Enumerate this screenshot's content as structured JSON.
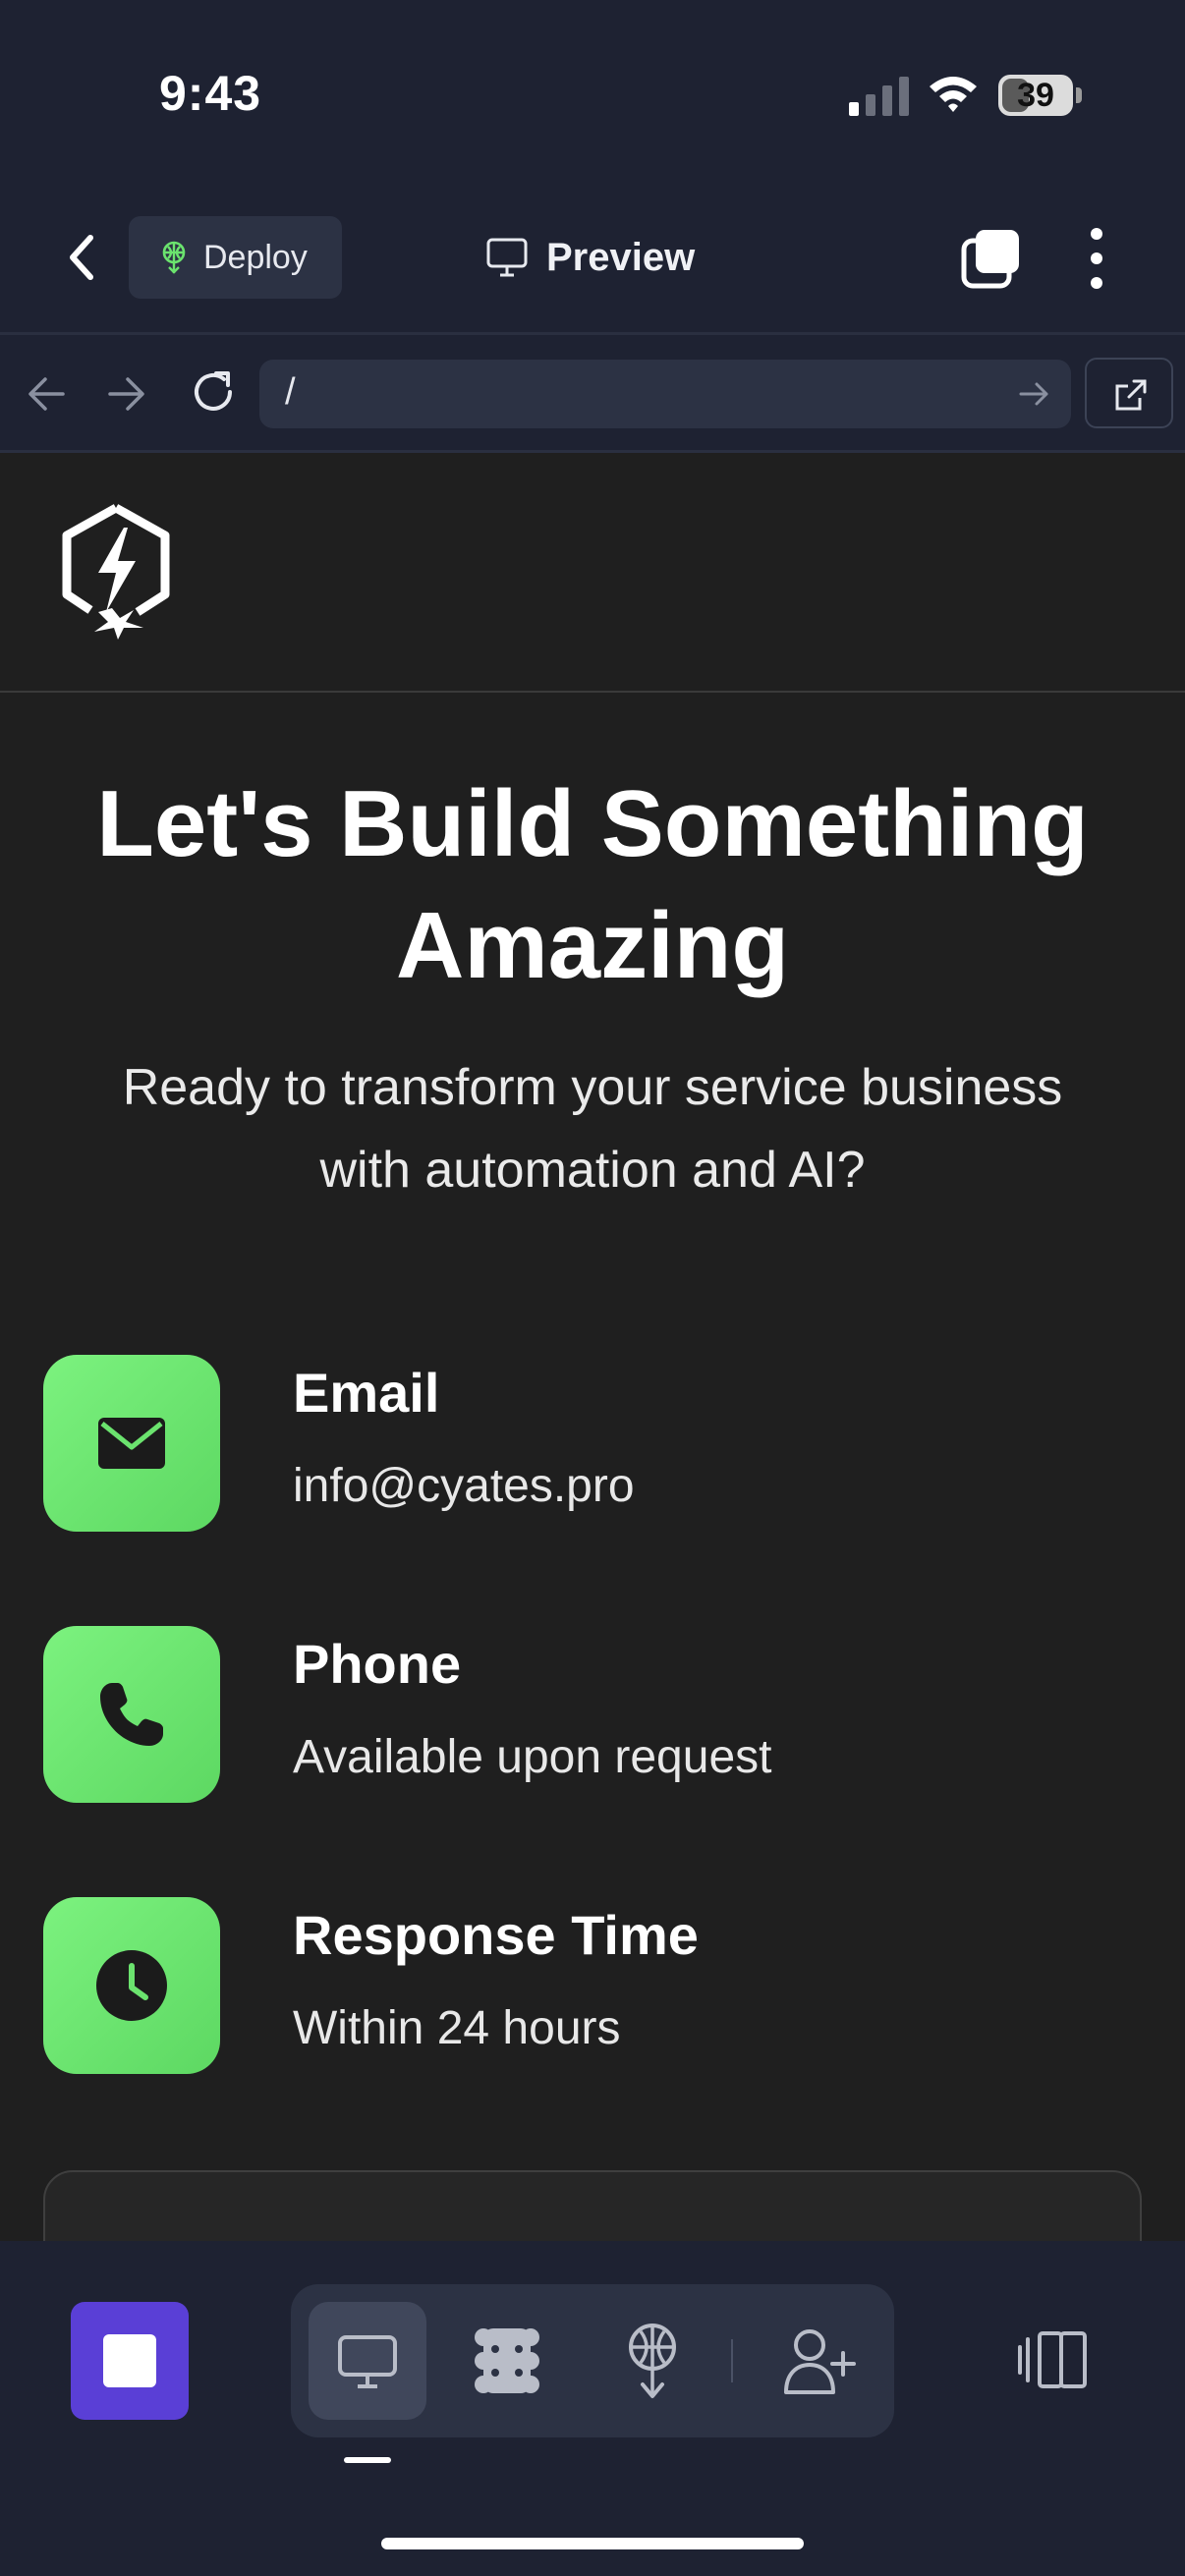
{
  "status_bar": {
    "time": "9:43",
    "battery": "39",
    "battery_level": 0.39
  },
  "app_bar": {
    "deploy_label": "Deploy",
    "preview_label": "Preview"
  },
  "browser": {
    "url": "/"
  },
  "page": {
    "headline_line1": "Let's Build Something",
    "headline_line2": "Amazing",
    "subhead_line1": "Ready to transform your service business",
    "subhead_line2": "with automation and AI?",
    "contacts": [
      {
        "title": "Email",
        "value": "info@cyates.pro",
        "icon": "mail-icon"
      },
      {
        "title": "Phone",
        "value": "Available upon request",
        "icon": "phone-icon"
      },
      {
        "title": "Response Time",
        "value": "Within 24 hours",
        "icon": "clock-icon"
      }
    ]
  },
  "bottom_bar": {
    "active_tab": "preview",
    "tabs": [
      "preview-icon",
      "apps-icon",
      "deploy-icon",
      "add-user-icon"
    ]
  },
  "colors": {
    "accent_green": "#6be36e",
    "stop_purple": "#5a3fd6",
    "chrome_bg": "#1e2232",
    "content_bg": "#1f1f1f"
  }
}
